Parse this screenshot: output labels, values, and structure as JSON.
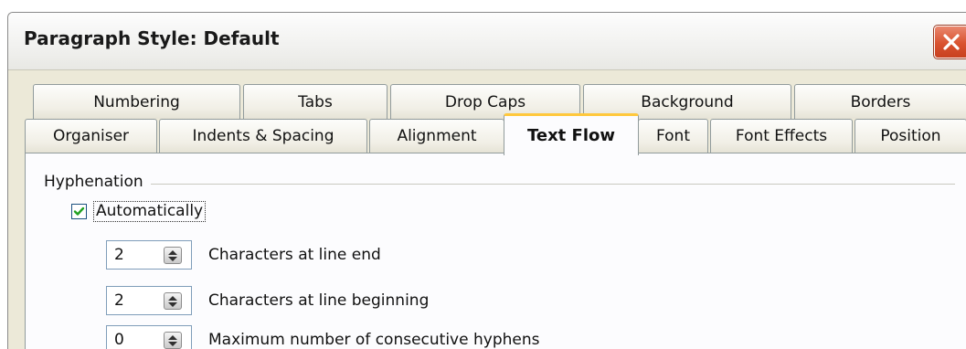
{
  "window": {
    "title": "Paragraph Style: Default",
    "close_icon": "close-x-icon"
  },
  "tabs": {
    "row1": [
      "Numbering",
      "Tabs",
      "Drop Caps",
      "Background",
      "Borders"
    ],
    "row2": [
      "Organiser",
      "Indents & Spacing",
      "Alignment",
      "Text Flow",
      "Font",
      "Font Effects",
      "Position"
    ],
    "active": "Text Flow"
  },
  "hyphenation": {
    "group_label": "Hyphenation",
    "automatically": {
      "label": "Automatically",
      "checked": true
    },
    "fields": [
      {
        "value": "2",
        "label": "Characters at line end"
      },
      {
        "value": "2",
        "label": "Characters at line beginning"
      },
      {
        "value": "0",
        "label": "Maximum number of consecutive hyphens"
      }
    ]
  },
  "colors": {
    "dialog_bg": "#ece9d8",
    "active_tab_accent": "#ffc83c",
    "close_button": "#d9522f",
    "checkmark": "#21a121"
  }
}
